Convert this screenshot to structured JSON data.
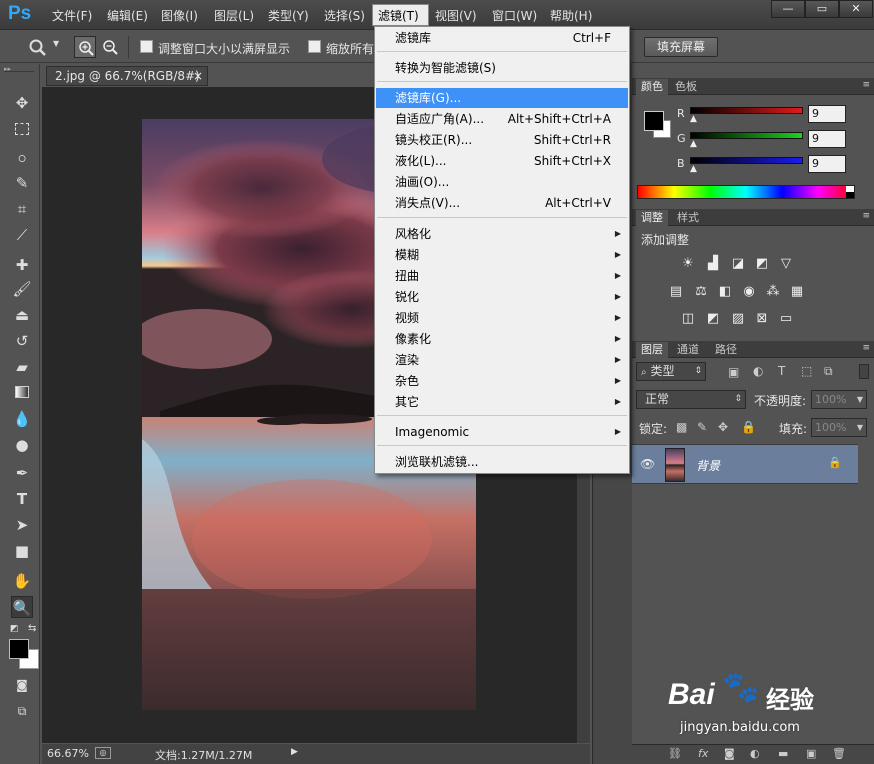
{
  "app": {
    "logo": "Ps"
  },
  "menubar": {
    "items": [
      "文件(F)",
      "编辑(E)",
      "图像(I)",
      "图层(L)",
      "类型(Y)",
      "选择(S)",
      "滤镜(T)",
      "视图(V)",
      "窗口(W)",
      "帮助(H)"
    ],
    "window_buttons": [
      "—",
      "▭",
      "✕"
    ]
  },
  "options": {
    "resize_windows_label": "调整窗口大小以满屏显示",
    "zoom_all_label": "缩放所有",
    "fill_screen_label": "填充屏幕"
  },
  "document": {
    "tab_title": "2.jpg @ 66.7%(RGB/8#)",
    "tab_close": "×",
    "zoom": "66.67%",
    "doc_info": "文档:1.27M/1.27M"
  },
  "filter_menu": {
    "items": [
      {
        "label": "滤镜库",
        "shortcut": "Ctrl+F"
      },
      {
        "label": "转换为智能滤镜(S)",
        "shortcut": ""
      },
      {
        "label": "滤镜库(G)...",
        "shortcut": "",
        "highlighted": true
      },
      {
        "label": "自适应广角(A)...",
        "shortcut": "Alt+Shift+Ctrl+A"
      },
      {
        "label": "镜头校正(R)...",
        "shortcut": "Shift+Ctrl+R"
      },
      {
        "label": "液化(L)...",
        "shortcut": "Shift+Ctrl+X"
      },
      {
        "label": "油画(O)...",
        "shortcut": ""
      },
      {
        "label": "消失点(V)...",
        "shortcut": "Alt+Ctrl+V"
      },
      {
        "label": "风格化",
        "submenu": true
      },
      {
        "label": "模糊",
        "submenu": true
      },
      {
        "label": "扭曲",
        "submenu": true
      },
      {
        "label": "锐化",
        "submenu": true
      },
      {
        "label": "视频",
        "submenu": true
      },
      {
        "label": "像素化",
        "submenu": true
      },
      {
        "label": "渲染",
        "submenu": true
      },
      {
        "label": "杂色",
        "submenu": true
      },
      {
        "label": "其它",
        "submenu": true
      },
      {
        "label": "Imagenomic",
        "submenu": true
      },
      {
        "label": "浏览联机滤镜...",
        "shortcut": ""
      }
    ]
  },
  "color_panel": {
    "tabs": [
      "颜色",
      "色板"
    ],
    "channels": [
      {
        "name": "R",
        "value": "9",
        "color": "#e11b1b"
      },
      {
        "name": "G",
        "value": "9",
        "color": "#1bd41b"
      },
      {
        "name": "B",
        "value": "9",
        "color": "#1b1bf0"
      }
    ]
  },
  "adjust_panel": {
    "tabs": [
      "调整",
      "样式"
    ],
    "title": "添加调整"
  },
  "layers_panel": {
    "tabs": [
      "图层",
      "通道",
      "路径"
    ],
    "kind_filter": "类型",
    "blend_mode": "正常",
    "opacity_label": "不透明度:",
    "opacity_value": "100%",
    "lock_label": "锁定:",
    "fill_label": "填充:",
    "fill_value": "100%",
    "layer_name": "背景"
  },
  "watermark": {
    "brand": "Bai",
    "brand_cn": "经验",
    "url": "jingyan.baidu.com"
  },
  "colors": {
    "accent": "#3e92f7",
    "ps_blue": "#31a8ff",
    "panel_bg": "#535353"
  }
}
